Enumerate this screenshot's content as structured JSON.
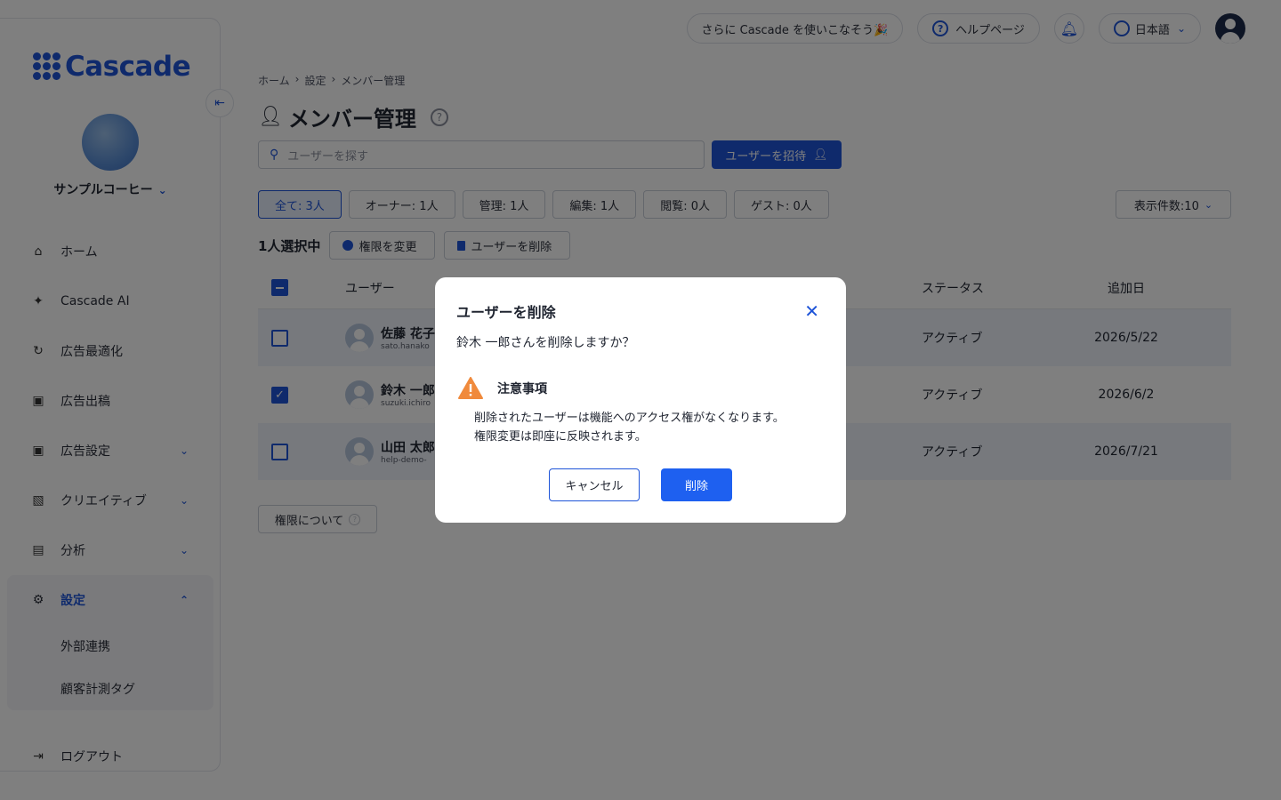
{
  "app": {
    "name": "Cascade"
  },
  "sidebar": {
    "org_name": "サンプルコーヒー",
    "items": [
      {
        "label": "ホーム",
        "icon": "home-icon"
      },
      {
        "label": "Cascade AI",
        "icon": "sparkle-icon"
      },
      {
        "label": "広告最適化",
        "icon": "optimize-icon"
      },
      {
        "label": "広告出稿",
        "icon": "publish-icon"
      },
      {
        "label": "広告設定",
        "icon": "ad-settings-icon"
      },
      {
        "label": "クリエイティブ",
        "icon": "image-icon"
      },
      {
        "label": "分析",
        "icon": "chart-icon"
      }
    ],
    "settings": {
      "label": "設定",
      "subitems": [
        "外部連携",
        "顧客計測タグ"
      ]
    },
    "logout": "ログアウト"
  },
  "topbar": {
    "promo": "さらに Cascade を使いこなそう🎉",
    "help": "ヘルプページ",
    "language": "日本語"
  },
  "page": {
    "breadcrumb": [
      "ホーム",
      "設定",
      "メンバー管理"
    ],
    "title": "メンバー管理",
    "search_placeholder": "ユーザーを探す",
    "invite_label": "ユーザーを招待",
    "filters": [
      "全て: 3人",
      "オーナー: 1人",
      "管理: 1人",
      "編集: 1人",
      "閲覧: 0人",
      "ゲスト: 0人"
    ],
    "per_page": "表示件数:10",
    "selected": "1人選択中",
    "change_role": "権限を変更",
    "delete_user": "ユーザーを削除",
    "columns": {
      "user": "ユーザー",
      "status": "ステータス",
      "added": "追加日"
    },
    "rows": [
      {
        "name": "佐藤 花子",
        "email": "sato.hanako",
        "status": "アクティブ",
        "date": "2026/5/22",
        "checked": false
      },
      {
        "name": "鈴木 一郎",
        "email": "suzuki.ichiro",
        "status": "アクティブ",
        "date": "2026/6/2",
        "checked": true
      },
      {
        "name": "山田 太郎",
        "email": "help-demo-",
        "status": "アクティブ",
        "date": "2026/7/21",
        "checked": false
      }
    ],
    "about_perms": "権限について"
  },
  "modal": {
    "title": "ユーザーを削除",
    "message": "鈴木 一郎さんを削除しますか？",
    "warning_title": "注意事項",
    "warning_line1": "削除されたユーザーは機能へのアクセス権がなくなります。",
    "warning_line2": "権限変更は即座に反映されます。",
    "cancel": "キャンセル",
    "delete": "削除"
  },
  "colors": {
    "accent": "#1e54d8",
    "warning": "#f08a3c"
  }
}
